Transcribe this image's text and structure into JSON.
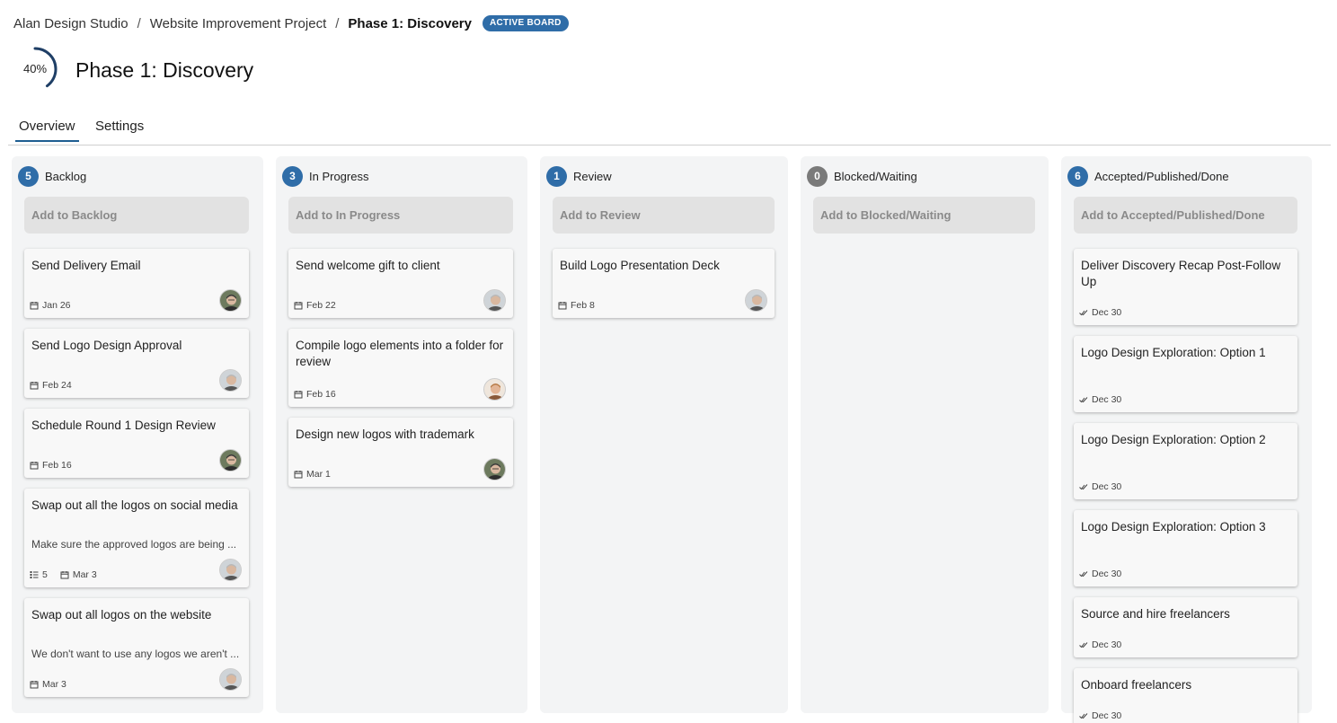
{
  "breadcrumb": {
    "org": "Alan Design Studio",
    "project": "Website Improvement Project",
    "current": "Phase 1: Discovery",
    "badge": "ACTIVE BOARD",
    "separator": "/"
  },
  "board": {
    "title": "Phase 1: Discovery",
    "progress_label": "40%",
    "progress_fraction": 0.4
  },
  "tabs": [
    {
      "label": "Overview",
      "active": true
    },
    {
      "label": "Settings",
      "active": false
    }
  ],
  "colors": {
    "accent": "#2f6da8",
    "progress_ring": "#1f3f66",
    "count_zero": "#7a7a7a"
  },
  "columns": [
    {
      "count": "5",
      "title": "Backlog",
      "add_label": "Add to Backlog",
      "cards": [
        {
          "title": "Send Delivery Email",
          "date": "Jan 26",
          "icon": "calendar-icon",
          "avatar": "avatar-man-glasses-dark"
        },
        {
          "title": "Send Logo Design Approval",
          "date": "Feb 24",
          "icon": "calendar-icon",
          "avatar": "avatar-man-gray"
        },
        {
          "title": "Schedule Round 1 Design Review",
          "date": "Feb 16",
          "icon": "calendar-icon",
          "avatar": "avatar-man-glasses-dark"
        },
        {
          "title": "Swap out all the logos on social media",
          "desc": "Make sure the approved logos are being ...",
          "checklist": "5",
          "date": "Mar 3",
          "icon": "calendar-icon",
          "avatar": "avatar-man-gray"
        },
        {
          "title": "Swap out all logos on the website",
          "desc": "We don't want to use any logos we aren't ...",
          "date": "Mar 3",
          "icon": "calendar-icon",
          "avatar": "avatar-man-gray"
        }
      ]
    },
    {
      "count": "3",
      "title": "In Progress",
      "add_label": "Add to In Progress",
      "cards": [
        {
          "title": "Send welcome gift to client",
          "date": "Feb 22",
          "icon": "calendar-icon",
          "avatar": "avatar-man-gray"
        },
        {
          "title": "Compile logo elements into a folder for review",
          "date": "Feb 16",
          "icon": "calendar-icon",
          "avatar": "avatar-woman"
        },
        {
          "title": "Design new logos with trademark",
          "date": "Mar 1",
          "icon": "calendar-icon",
          "avatar": "avatar-man-glasses-dark"
        }
      ]
    },
    {
      "count": "1",
      "title": "Review",
      "add_label": "Add to Review",
      "cards": [
        {
          "title": "Build Logo Presentation Deck",
          "date": "Feb 8",
          "icon": "calendar-icon",
          "avatar": "avatar-man-gray"
        }
      ]
    },
    {
      "count": "0",
      "title": "Blocked/Waiting",
      "add_label": "Add to Blocked/Waiting",
      "cards": []
    },
    {
      "count": "6",
      "title": "Accepted/Published/Done",
      "add_label": "Add to Accepted/Published/Done",
      "cards": [
        {
          "title": "Deliver Discovery Recap Post-Follow Up",
          "date": "Dec 30",
          "icon": "double-check-icon"
        },
        {
          "title": "Logo Design Exploration: Option 1",
          "date": "Dec 30",
          "icon": "double-check-icon"
        },
        {
          "title": "Logo Design Exploration: Option 2",
          "date": "Dec 30",
          "icon": "double-check-icon"
        },
        {
          "title": "Logo Design Exploration: Option 3",
          "date": "Dec 30",
          "icon": "double-check-icon"
        },
        {
          "title": "Source and hire freelancers",
          "date": "Dec 30",
          "icon": "double-check-icon"
        },
        {
          "title": "Onboard freelancers",
          "date": "Dec 30",
          "icon": "double-check-icon"
        }
      ]
    }
  ]
}
